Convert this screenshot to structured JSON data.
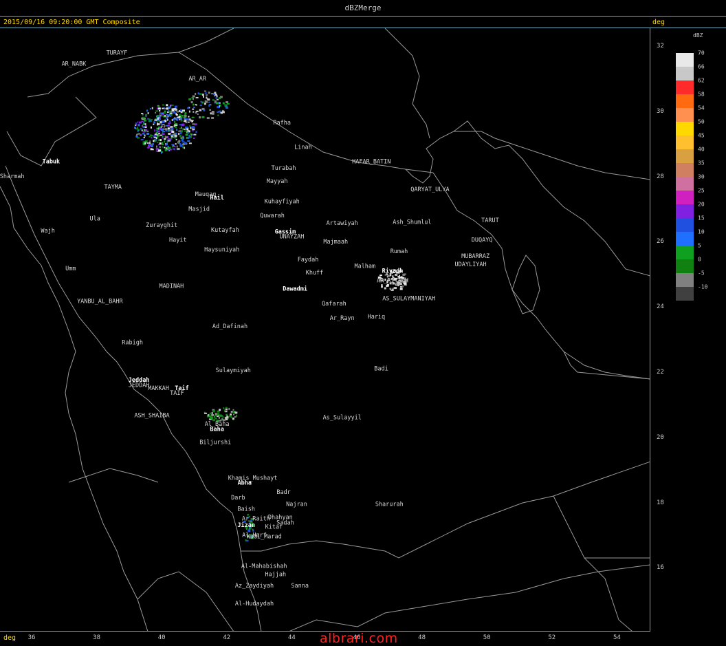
{
  "window": {
    "title": "dBZMerge"
  },
  "header": {
    "timestamp": "2015/09/16 09:20:00 GMT Composite",
    "unit_top": "deg",
    "unit_bottom": "deg"
  },
  "watermark": "albrari.com",
  "axes": {
    "x_ticks": [
      36,
      38,
      40,
      42,
      44,
      46,
      48,
      50,
      52,
      54
    ],
    "y_ticks": [
      32,
      30,
      28,
      26,
      24,
      22,
      20,
      18,
      16
    ]
  },
  "legend": {
    "title": "dBZ",
    "entries": [
      {
        "label": "70",
        "color": "#e8e8e8"
      },
      {
        "label": "66",
        "color": "#c8c8c8"
      },
      {
        "label": "62",
        "color": "#ff2a2a"
      },
      {
        "label": "58",
        "color": "#ff6a10"
      },
      {
        "label": "54",
        "color": "#ff9050"
      },
      {
        "label": "50",
        "color": "#ffd800"
      },
      {
        "label": "45",
        "color": "#ffc030"
      },
      {
        "label": "40",
        "color": "#d8a040"
      },
      {
        "label": "35",
        "color": "#d08060"
      },
      {
        "label": "30",
        "color": "#d070a0"
      },
      {
        "label": "25",
        "color": "#d020c0"
      },
      {
        "label": "20",
        "color": "#8020e0"
      },
      {
        "label": "15",
        "color": "#2050e0"
      },
      {
        "label": "10",
        "color": "#2070ff"
      },
      {
        "label": "5",
        "color": "#10a020"
      },
      {
        "label": "0",
        "color": "#108010"
      },
      {
        "label": "-5",
        "color": "#808080"
      },
      {
        "label": "-10",
        "color": "#404040"
      }
    ]
  },
  "cities": [
    {
      "name": "TURAYF",
      "lon": 38.62,
      "lat": 31.74,
      "bold": false
    },
    {
      "name": "AR_NABK",
      "lon": 37.3,
      "lat": 31.4,
      "bold": false
    },
    {
      "name": "AR_AR",
      "lon": 41.1,
      "lat": 30.95,
      "bold": false
    },
    {
      "name": "Rafha",
      "lon": 43.7,
      "lat": 29.6,
      "bold": false
    },
    {
      "name": "Linah",
      "lon": 44.35,
      "lat": 28.85,
      "bold": false
    },
    {
      "name": "Turabah",
      "lon": 43.75,
      "lat": 28.2,
      "bold": false
    },
    {
      "name": "HAFAR_BATIN",
      "lon": 46.45,
      "lat": 28.4,
      "bold": false
    },
    {
      "name": "Mayyah",
      "lon": 43.55,
      "lat": 27.8,
      "bold": false
    },
    {
      "name": "QARYAT_ULYA",
      "lon": 48.25,
      "lat": 27.55,
      "bold": false
    },
    {
      "name": "Tabuk",
      "lon": 36.6,
      "lat": 28.4,
      "bold": true
    },
    {
      "name": "Sharmah",
      "lon": 35.4,
      "lat": 27.95,
      "bold": false
    },
    {
      "name": "TAYMA",
      "lon": 38.5,
      "lat": 27.62,
      "bold": false
    },
    {
      "name": "Mauqaq",
      "lon": 41.35,
      "lat": 27.4,
      "bold": false
    },
    {
      "name": "Hail",
      "lon": 41.7,
      "lat": 27.3,
      "bold": true
    },
    {
      "name": "Kuhayfiyah",
      "lon": 43.7,
      "lat": 27.18,
      "bold": false
    },
    {
      "name": "Masjid",
      "lon": 41.15,
      "lat": 26.95,
      "bold": false
    },
    {
      "name": "Quwarah",
      "lon": 43.4,
      "lat": 26.75,
      "bold": false
    },
    {
      "name": "Ula",
      "lon": 37.95,
      "lat": 26.65,
      "bold": false
    },
    {
      "name": "Artawiyah",
      "lon": 45.55,
      "lat": 26.52,
      "bold": false
    },
    {
      "name": "Ash_Shumlul",
      "lon": 47.7,
      "lat": 26.55,
      "bold": false
    },
    {
      "name": "TARUT",
      "lon": 50.1,
      "lat": 26.6,
      "bold": false
    },
    {
      "name": "Zurayghit",
      "lon": 40.0,
      "lat": 26.45,
      "bold": false
    },
    {
      "name": "Kutayfah",
      "lon": 41.95,
      "lat": 26.3,
      "bold": false
    },
    {
      "name": "Gassim",
      "lon": 43.8,
      "lat": 26.25,
      "bold": true
    },
    {
      "name": "UNAYZAH",
      "lon": 44.0,
      "lat": 26.1,
      "bold": false
    },
    {
      "name": "Wajh",
      "lon": 36.5,
      "lat": 26.28,
      "bold": false
    },
    {
      "name": "Hayit",
      "lon": 40.5,
      "lat": 26.0,
      "bold": false
    },
    {
      "name": "Majmaah",
      "lon": 45.35,
      "lat": 25.95,
      "bold": false
    },
    {
      "name": "DUQAYQ",
      "lon": 49.85,
      "lat": 26.0,
      "bold": false
    },
    {
      "name": "Haysuniyah",
      "lon": 41.85,
      "lat": 25.7,
      "bold": false
    },
    {
      "name": "Rumah",
      "lon": 47.3,
      "lat": 25.65,
      "bold": false
    },
    {
      "name": "MUBARRAZ",
      "lon": 49.65,
      "lat": 25.5,
      "bold": false
    },
    {
      "name": "Faydah",
      "lon": 44.5,
      "lat": 25.4,
      "bold": false
    },
    {
      "name": "Malham",
      "lon": 46.25,
      "lat": 25.2,
      "bold": false
    },
    {
      "name": "UDAYLIYAH",
      "lon": 49.5,
      "lat": 25.25,
      "bold": false
    },
    {
      "name": "Khuff",
      "lon": 44.7,
      "lat": 25.0,
      "bold": false
    },
    {
      "name": "Riyadh",
      "lon": 47.1,
      "lat": 25.05,
      "bold": true
    },
    {
      "name": "Umm",
      "lon": 37.2,
      "lat": 25.12,
      "bold": false
    },
    {
      "name": "AR_RIYADH",
      "lon": 47.1,
      "lat": 24.75,
      "bold": false
    },
    {
      "name": "MADINAH",
      "lon": 40.3,
      "lat": 24.58,
      "bold": false
    },
    {
      "name": "Dawadmi",
      "lon": 44.1,
      "lat": 24.5,
      "bold": true
    },
    {
      "name": "AS_SULAYMANIYAH",
      "lon": 47.6,
      "lat": 24.2,
      "bold": false
    },
    {
      "name": "YANBU_AL_BAHR",
      "lon": 38.1,
      "lat": 24.12,
      "bold": false
    },
    {
      "name": "Qafarah",
      "lon": 45.3,
      "lat": 24.05,
      "bold": false
    },
    {
      "name": "Hariq",
      "lon": 46.6,
      "lat": 23.65,
      "bold": false
    },
    {
      "name": "Ar_Rayn",
      "lon": 45.55,
      "lat": 23.6,
      "bold": false
    },
    {
      "name": "Ad_Dafinah",
      "lon": 42.1,
      "lat": 23.35,
      "bold": false
    },
    {
      "name": "Rabigh",
      "lon": 39.1,
      "lat": 22.85,
      "bold": false
    },
    {
      "name": "Badi",
      "lon": 46.75,
      "lat": 22.05,
      "bold": false
    },
    {
      "name": "Sulaymiyah",
      "lon": 42.2,
      "lat": 22.0,
      "bold": false
    },
    {
      "name": "Jeddah",
      "lon": 39.3,
      "lat": 21.7,
      "bold": true
    },
    {
      "name": "JEDDAH",
      "lon": 39.3,
      "lat": 21.55,
      "bold": false
    },
    {
      "name": "MAKKAH",
      "lon": 39.9,
      "lat": 21.45,
      "bold": false
    },
    {
      "name": "Taif",
      "lon": 40.62,
      "lat": 21.45,
      "bold": true
    },
    {
      "name": "TAIF",
      "lon": 40.47,
      "lat": 21.3,
      "bold": false
    },
    {
      "name": "ASH_SHAIBA",
      "lon": 39.7,
      "lat": 20.62,
      "bold": false
    },
    {
      "name": "As_Sulayyil",
      "lon": 45.55,
      "lat": 20.55,
      "bold": false
    },
    {
      "name": "Al_Baha",
      "lon": 41.7,
      "lat": 20.35,
      "bold": false
    },
    {
      "name": "Baha",
      "lon": 41.7,
      "lat": 20.2,
      "bold": true
    },
    {
      "name": "Biljurshi",
      "lon": 41.65,
      "lat": 19.8,
      "bold": false
    },
    {
      "name": "Khamis_Mushayt",
      "lon": 42.8,
      "lat": 18.7,
      "bold": false
    },
    {
      "name": "Abha",
      "lon": 42.55,
      "lat": 18.55,
      "bold": true
    },
    {
      "name": "Badr",
      "lon": 43.75,
      "lat": 18.27,
      "bold": false
    },
    {
      "name": "Darb",
      "lon": 42.35,
      "lat": 18.1,
      "bold": false
    },
    {
      "name": "Najran",
      "lon": 44.15,
      "lat": 17.9,
      "bold": false
    },
    {
      "name": "Sharurah",
      "lon": 47.0,
      "lat": 17.9,
      "bold": false
    },
    {
      "name": "Baish",
      "lon": 42.6,
      "lat": 17.75,
      "bold": false
    },
    {
      "name": "Ar_Raith",
      "lon": 42.9,
      "lat": 17.45,
      "bold": false
    },
    {
      "name": "Dhahyan",
      "lon": 43.65,
      "lat": 17.5,
      "bold": false
    },
    {
      "name": "Sadah",
      "lon": 43.8,
      "lat": 17.33,
      "bold": false
    },
    {
      "name": "Jizan",
      "lon": 42.6,
      "lat": 17.25,
      "bold": true
    },
    {
      "name": "Kitaf",
      "lon": 43.45,
      "lat": 17.2,
      "bold": false
    },
    {
      "name": "Al_Harf",
      "lon": 42.85,
      "lat": 16.95,
      "bold": false
    },
    {
      "name": "Wadi_Marad",
      "lon": 43.15,
      "lat": 16.9,
      "bold": false
    },
    {
      "name": "Al-Mahabishah",
      "lon": 43.15,
      "lat": 16.0,
      "bold": false
    },
    {
      "name": "Hajjah",
      "lon": 43.5,
      "lat": 15.75,
      "bold": false
    },
    {
      "name": "Az_Zaydiyah",
      "lon": 42.85,
      "lat": 15.4,
      "bold": false
    },
    {
      "name": "Sanna",
      "lon": 44.25,
      "lat": 15.4,
      "bold": false
    },
    {
      "name": "Al-Hudaydah",
      "lon": 42.85,
      "lat": 14.85,
      "bold": false
    }
  ]
}
